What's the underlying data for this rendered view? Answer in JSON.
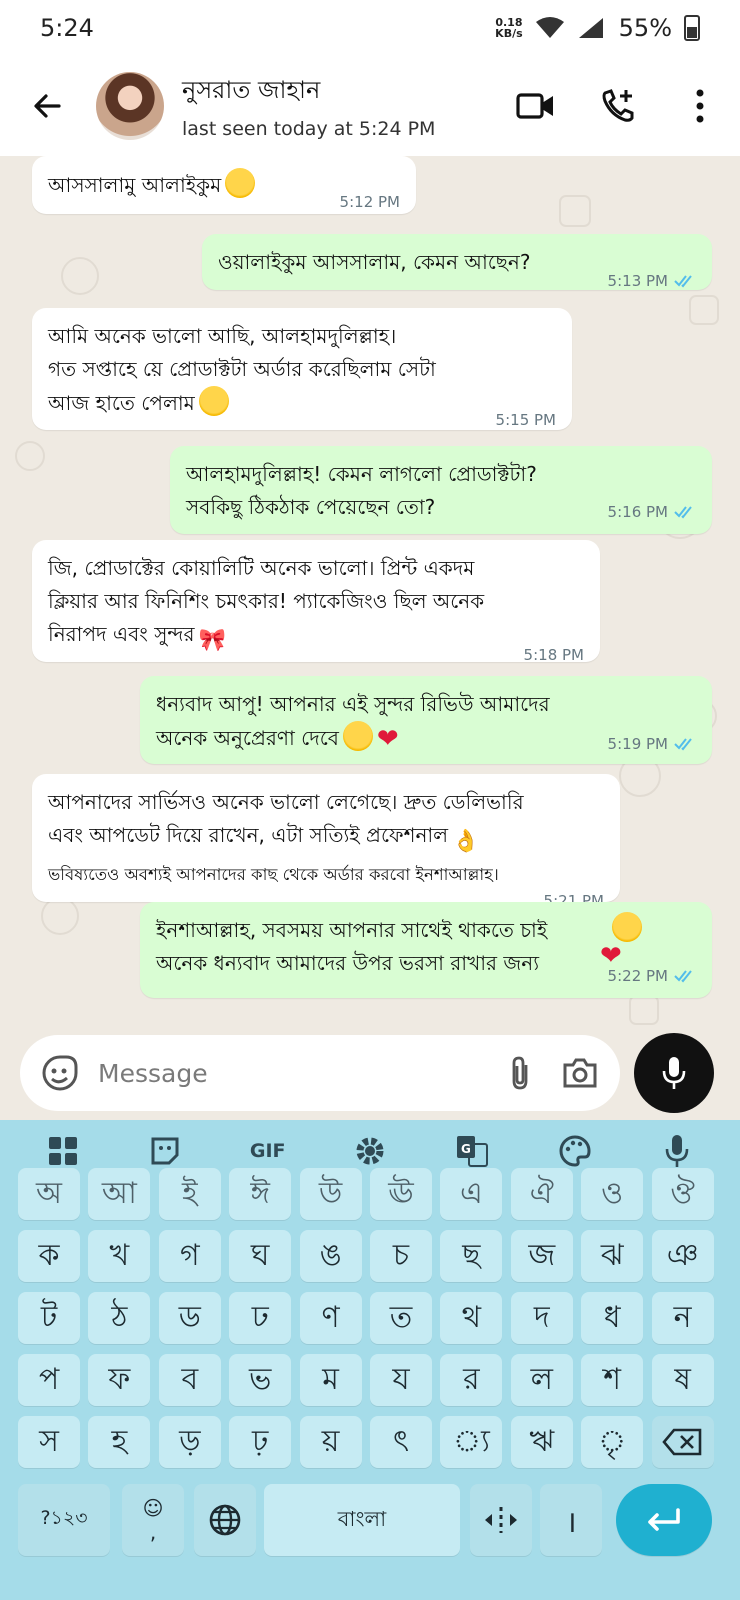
{
  "status_bar": {
    "time": "5:24",
    "net_speed": "0.18",
    "net_unit": "KB/s",
    "battery": "55%"
  },
  "header": {
    "contact_name": "নুসরাত জাহান",
    "last_seen": "last seen today at 5:24 PM"
  },
  "messages": [
    {
      "dir": "in",
      "text": "আসসালামু আলাইকুম",
      "emoji": "smile",
      "time": "5:12 PM"
    },
    {
      "dir": "out",
      "text": "ওয়ালাইকুম আসসালাম, কেমন আছেন?",
      "time": "5:13 PM",
      "read": true
    },
    {
      "dir": "in",
      "text": "আমি অনেক ভালো আছি, আলহামদুলিল্লাহ।\nগত সপ্তাহে য়ে প্রোডাক্টটা অর্ডার করেছিলাম সেটা\nআজ হাতে পেলাম",
      "emoji": "heart-eyes",
      "time": "5:15 PM"
    },
    {
      "dir": "out",
      "text": "আলহামদুলিল্লাহ! কেমন লাগলো প্রোডাক্টটা?\nসবকিছু ঠিকঠাক পেয়েছেন তো?",
      "time": "5:16 PM",
      "read": true
    },
    {
      "dir": "in",
      "text": "জি, প্রোডাক্টের কোয়ালিটি অনেক ভালো। প্রিন্ট একদম\nক্লিয়ার আর ফিনিশিং চমৎকার! প্যাকেজিংও ছিল অনেক\nনিরাপদ এবং সুন্দর",
      "emoji": "bow",
      "time": "5:18 PM"
    },
    {
      "dir": "out",
      "text": "ধন্যবাদ আপু! আপনার এই সুন্দর রিভিউ আমাদের\nঅনেক অনুপ্রেরণা দেবে",
      "emoji": "smile-heart",
      "time": "5:19 PM",
      "read": true
    },
    {
      "dir": "in",
      "text": "আপনাদের সার্ভিসও অনেক ভালো লেগেছে। দ্রুত ডেলিভারি\nএবং আপডেট দিয়ে রাখেন, এটা সত্যিই প্রফেশনাল",
      "emoji": "ok-hand",
      "text_small": "ভবিষ্যতেও অবশ্যই আপনাদের কাছ থেকে অর্ডার করবো ইনশাআল্লাহ।",
      "time": "5:21 PM"
    },
    {
      "dir": "out",
      "text": "ইনশাআল্লাহ, সবসময় আপনার সাথেই থাকতে চাই\nঅনেক ধন্যবাদ আমাদের উপর ভরসা রাখার জন্য",
      "emoji": "smile-heart2",
      "time": "5:22 PM",
      "read": true
    }
  ],
  "input": {
    "placeholder": "Message"
  },
  "keyboard": {
    "toolbar": [
      "apps-icon",
      "sticker-icon",
      "GIF",
      "settings-icon",
      "translate-icon",
      "palette-icon",
      "mic-icon"
    ],
    "gif_label": "GIF",
    "rows": [
      [
        "অ",
        "আ",
        "ই",
        "ঈ",
        "উ",
        "ঊ",
        "এ",
        "ঐ",
        "ও",
        "ঔ"
      ],
      [
        "ক",
        "খ",
        "গ",
        "ঘ",
        "ঙ",
        "চ",
        "ছ",
        "জ",
        "ঝ",
        "ঞ"
      ],
      [
        "ট",
        "ঠ",
        "ড",
        "ঢ",
        "ণ",
        "ত",
        "থ",
        "দ",
        "ধ",
        "ন"
      ],
      [
        "প",
        "ফ",
        "ব",
        "ভ",
        "ম",
        "য",
        "র",
        "ল",
        "শ",
        "ষ"
      ],
      [
        "স",
        "হ",
        "ড়",
        "ঢ়",
        "য়",
        "ৎ",
        "্য",
        "ঋ",
        "ৃ"
      ]
    ],
    "symbols_key": "?১২৩",
    "emoji_key_sub": ",",
    "space_label": "বাংলা",
    "danda": "।"
  }
}
